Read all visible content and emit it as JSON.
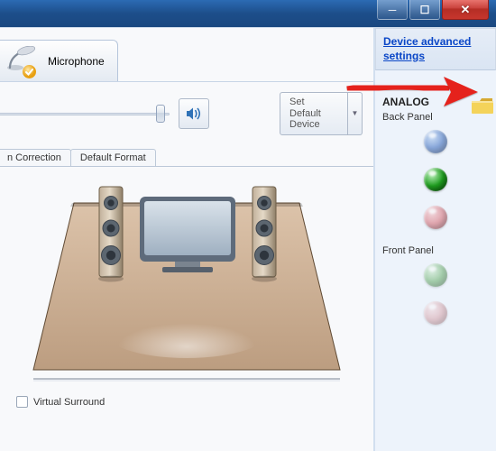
{
  "titlebar": {},
  "header_tab": {
    "mic_label": "Microphone"
  },
  "toolbar": {
    "set_default_label": "Set Default\nDevice"
  },
  "tabs": {
    "correction": "n Correction",
    "default_format": "Default Format"
  },
  "options": {
    "virtual_surround_label": "Virtual Surround"
  },
  "sidebar": {
    "advanced_link": "Device advanced settings",
    "analog_title": "ANALOG",
    "back_panel_label": "Back Panel",
    "front_panel_label": "Front Panel"
  },
  "jacks": {
    "back": [
      "blue",
      "green",
      "pink"
    ],
    "front": [
      "green",
      "pink"
    ]
  }
}
